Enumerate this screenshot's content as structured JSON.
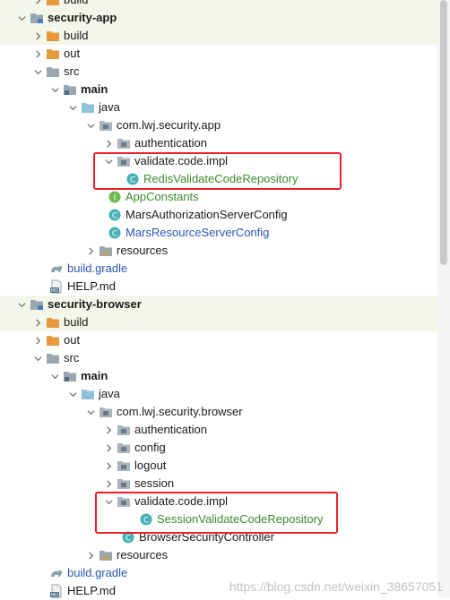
{
  "colors": {
    "highlight_band": "#f3f7ea",
    "red_box": "#e8222a",
    "folder_blue": "#8fc1d8",
    "folder_orange": "#e69a3c",
    "folder_gray": "#9aa7b0",
    "class_teal": "#45b1b6",
    "interface_green": "#6fb94f",
    "gradle_green": "#3b8b2e",
    "link_blue": "#2a56b5"
  },
  "tree": {
    "top": {
      "label": "build",
      "icon": "orange-folder-icon"
    },
    "app": {
      "module": {
        "label": "security-app",
        "icon": "module-folder-icon"
      },
      "build": {
        "label": "build",
        "icon": "orange-folder-icon"
      },
      "out": {
        "label": "out",
        "icon": "orange-folder-icon"
      },
      "src": {
        "label": "src",
        "icon": "gray-folder-icon"
      },
      "main": {
        "label": "main",
        "icon": "source-root-folder-icon"
      },
      "java": {
        "label": "java",
        "icon": "blue-folder-icon"
      },
      "package": {
        "label": "com.lwj.security.app",
        "icon": "package-icon"
      },
      "authentication": {
        "label": "authentication",
        "icon": "package-icon"
      },
      "validate": {
        "label": "validate.code.impl",
        "icon": "package-icon"
      },
      "redis": {
        "label": "RedisValidateCodeRepository",
        "icon": "class-icon"
      },
      "appconstants": {
        "label": "AppConstants",
        "icon": "interface-icon"
      },
      "authserver": {
        "label": "MarsAuthorizationServerConfig",
        "icon": "class-icon"
      },
      "resserver": {
        "label": "MarsResourceServerConfig",
        "icon": "class-icon"
      },
      "resources": {
        "label": "resources",
        "icon": "resources-folder-icon"
      },
      "gradle": {
        "label": "build.gradle",
        "icon": "gradle-icon"
      },
      "help": {
        "label": "HELP.md",
        "icon": "markdown-icon"
      }
    },
    "browser": {
      "module": {
        "label": "security-browser",
        "icon": "module-folder-icon"
      },
      "build": {
        "label": "build",
        "icon": "orange-folder-icon"
      },
      "out": {
        "label": "out",
        "icon": "orange-folder-icon"
      },
      "src": {
        "label": "src",
        "icon": "gray-folder-icon"
      },
      "main": {
        "label": "main",
        "icon": "source-root-folder-icon"
      },
      "java": {
        "label": "java",
        "icon": "blue-folder-icon"
      },
      "package": {
        "label": "com.lwj.security.browser",
        "icon": "package-icon"
      },
      "authentication": {
        "label": "authentication",
        "icon": "package-icon"
      },
      "config": {
        "label": "config",
        "icon": "package-icon"
      },
      "logout": {
        "label": "logout",
        "icon": "package-icon"
      },
      "session": {
        "label": "session",
        "icon": "package-icon"
      },
      "validate": {
        "label": "validate.code.impl",
        "icon": "package-icon"
      },
      "sessionrepo": {
        "label": "SessionValidateCodeRepository",
        "icon": "class-icon"
      },
      "controller": {
        "label": "BrowserSecurityController",
        "icon": "class-icon"
      },
      "resources": {
        "label": "resources",
        "icon": "resources-folder-icon"
      },
      "gradle": {
        "label": "build.gradle",
        "icon": "gradle-icon"
      },
      "help": {
        "label": "HELP.md",
        "icon": "markdown-icon"
      }
    }
  },
  "watermark": "https://blog.csdn.net/weixin_38657051"
}
